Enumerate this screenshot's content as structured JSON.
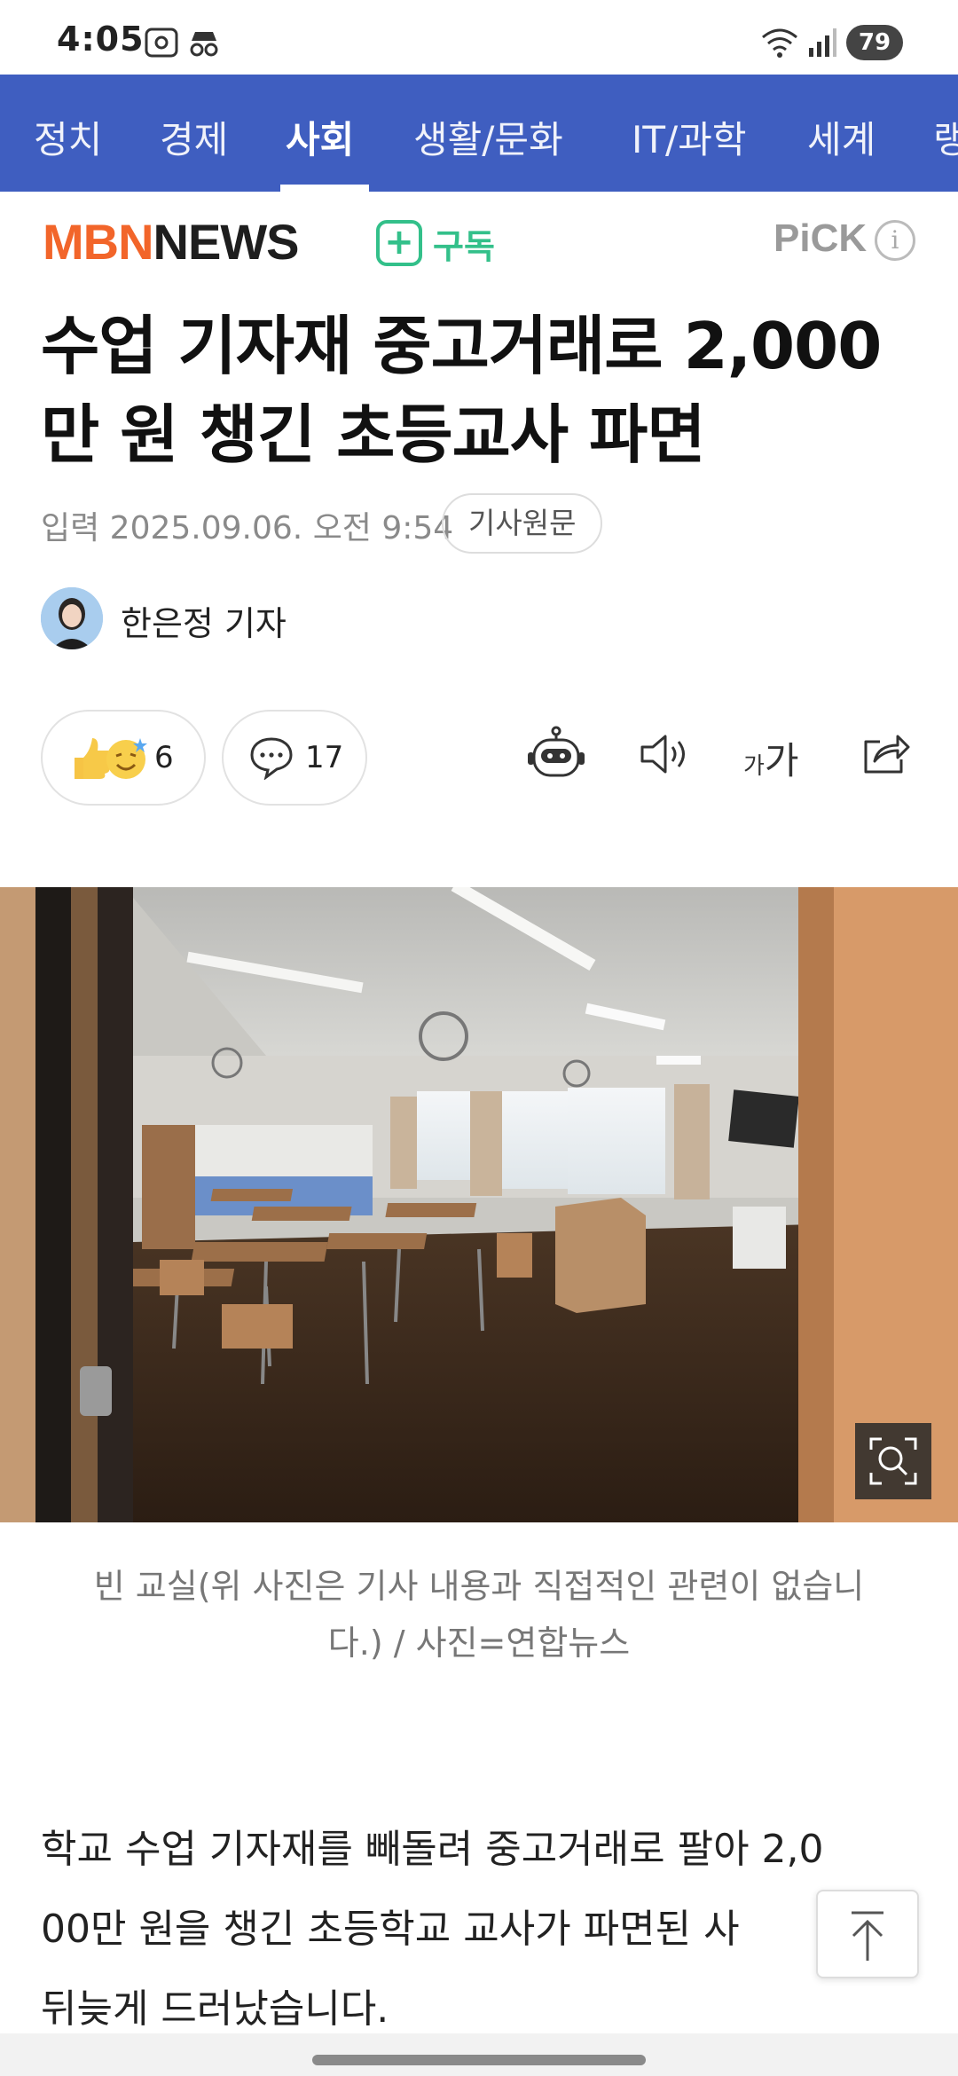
{
  "status_bar": {
    "time": "4:05",
    "battery": "79"
  },
  "nav": {
    "categories": [
      "정치",
      "경제",
      "사회",
      "생활/문화",
      "IT/과학",
      "세계",
      "랭"
    ],
    "active": "사회"
  },
  "publisher": {
    "brand_a": "MBN",
    "brand_b": "NEWS",
    "subscribe": "구독",
    "pick": "PiCK",
    "info": "i"
  },
  "article": {
    "title_line1": "수업 기자재 중고거래로 2,000",
    "title_line2": "만 원 챙긴 초등교사 파면",
    "date": "입력 2025.09.06. 오전 9:54",
    "original_button": "기사원문",
    "reporter": "한은정 기자",
    "reactions_count": "6",
    "comments_count": "17",
    "font_size_label_small": "가",
    "font_size_label_large": "가",
    "caption_line1": "빈 교실(위 사진은 기사 내용과 직접적인 관련이 없습니",
    "caption_line2": "다.) / 사진=연합뉴스",
    "body_line1": "학교 수업 기자재를 빼돌려 중고거래로 팔아 2,0",
    "body_line2": "00만 원을 챙긴 초등학교 교사가 파면된 사",
    "body_line3": "뒤늦게 드러났습니다."
  },
  "colors": {
    "nav_bg": "#3f5ec0",
    "brand_orange": "#f2652a",
    "subscribe_green": "#33c08a"
  }
}
